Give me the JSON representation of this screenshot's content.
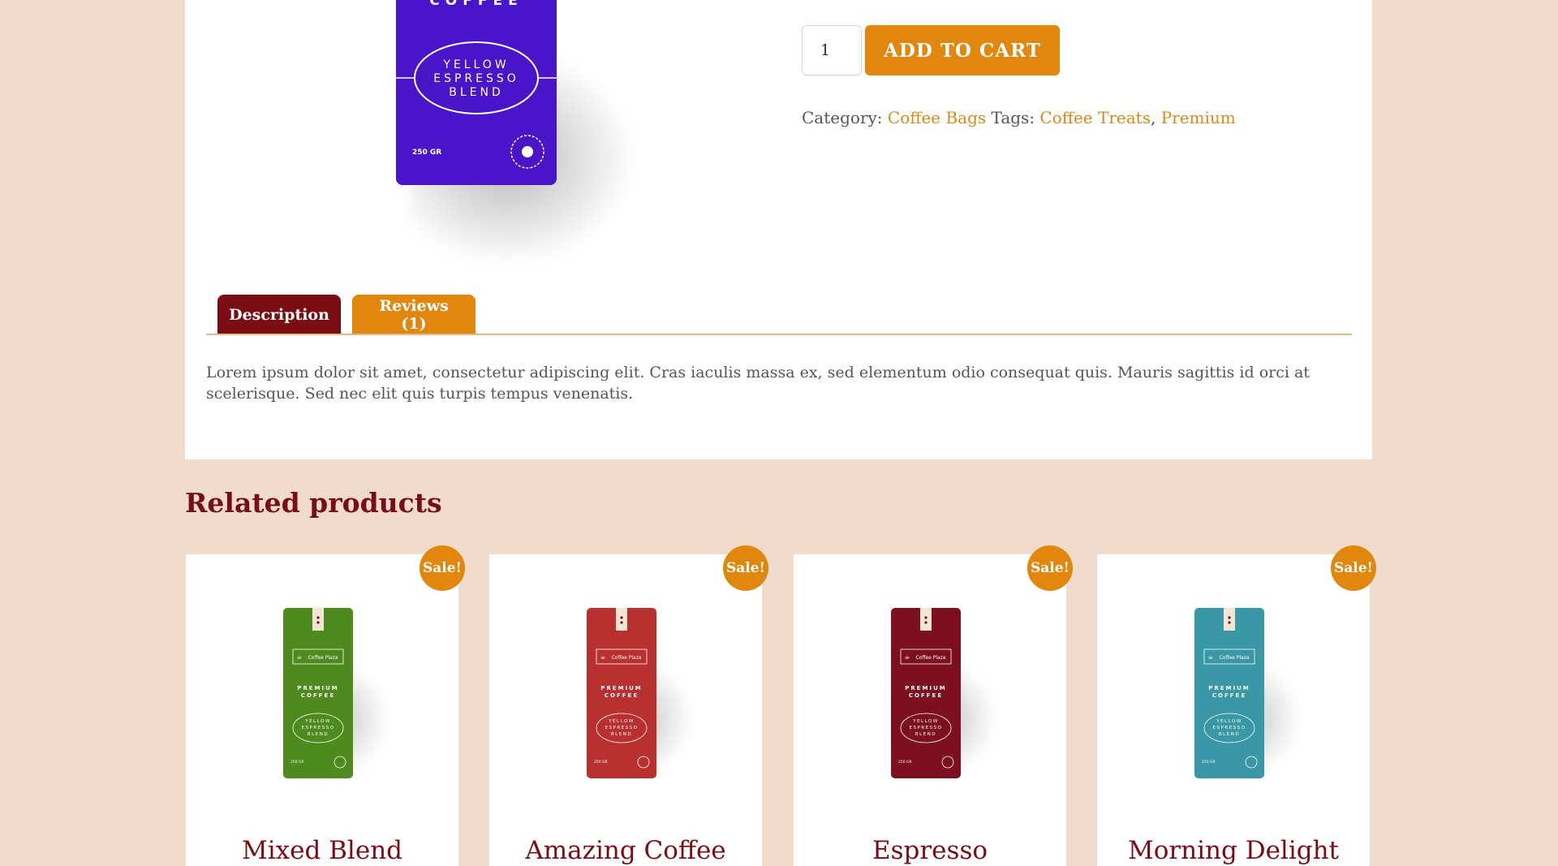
{
  "product": {
    "bag": {
      "brand_line": "COFFEE",
      "blend_line1": "YELLOW",
      "blend_line2": "ESPRESSO",
      "blend_line3": "BLEND",
      "weight": "250 GR",
      "color": "#4a14c8"
    },
    "quantity": "1",
    "add_to_cart_label": "ADD TO CART",
    "meta": {
      "category_label": "Category:",
      "category_link": "Coffee Bags",
      "tags_label": "Tags:",
      "tag1": "Coffee Treats",
      "separator": ",",
      "tag2": "Premium"
    },
    "tabs": {
      "description": "Description",
      "reviews": "Reviews (1)"
    },
    "description": "Lorem ipsum dolor sit amet, consectetur adipiscing elit. Cras iaculis massa ex, sed elementum odio consequat quis. Mauris sagittis id orci at scelerisque. Sed nec elit quis turpis tempus venenatis."
  },
  "related": {
    "heading": "Related products",
    "sale_label": "Sale!",
    "bag_text": {
      "brand": "Coffee Plaza",
      "line1": "PREMIUM",
      "line2": "COFFEE",
      "blend1": "YELLOW",
      "blend2": "ESPRESSO",
      "blend3": "BLEND",
      "weight": "250 GR"
    },
    "items": [
      {
        "title": "Mixed Blend",
        "color": "#4f8a1e"
      },
      {
        "title": "Amazing Coffee",
        "color": "#b8302f"
      },
      {
        "title": "Espresso",
        "color": "#7c1021"
      },
      {
        "title": "Morning Delight",
        "color": "#3a97a5"
      }
    ]
  }
}
